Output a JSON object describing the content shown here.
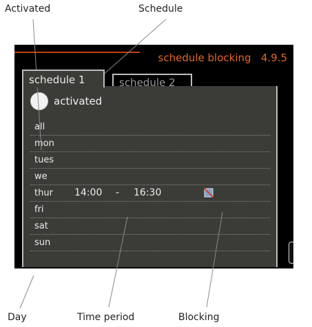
{
  "callouts": {
    "activated": "Activated",
    "schedule": "Schedule",
    "day": "Day",
    "time_period": "Time period",
    "blocking": "Blocking"
  },
  "screen": {
    "title": "schedule blocking",
    "menu_number": "4.9.5",
    "accent_color": "#e3672b",
    "tabs": [
      {
        "label": "schedule 1",
        "active": true
      },
      {
        "label": "schedule 2",
        "active": false
      }
    ],
    "activated_label": "activated",
    "days": [
      {
        "label": "all",
        "start": "",
        "dash": "",
        "end": ""
      },
      {
        "label": "mon",
        "start": "",
        "dash": "",
        "end": ""
      },
      {
        "label": "tues",
        "start": "",
        "dash": "",
        "end": ""
      },
      {
        "label": "we",
        "start": "",
        "dash": "",
        "end": ""
      },
      {
        "label": "thur",
        "start": "14:00",
        "dash": "-",
        "end": "16:30",
        "blocking_icon": "blocking-icon"
      },
      {
        "label": "fri",
        "start": "",
        "dash": "",
        "end": ""
      },
      {
        "label": "sat",
        "start": "",
        "dash": "",
        "end": ""
      },
      {
        "label": "sun",
        "start": "",
        "dash": "",
        "end": ""
      }
    ],
    "help_label": "?",
    "side_icons": [
      "gear-icon",
      "clock-icon"
    ]
  }
}
